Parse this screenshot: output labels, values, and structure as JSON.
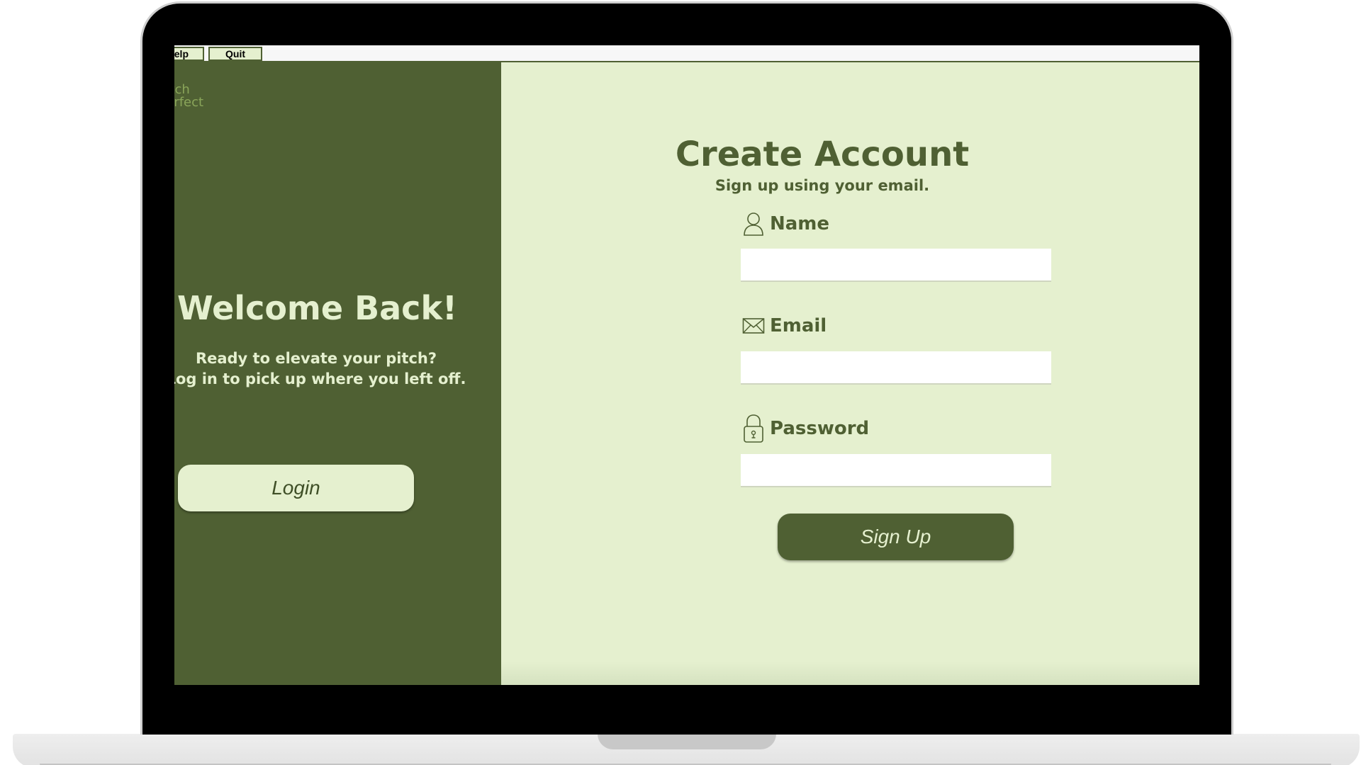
{
  "menubar": {
    "help_label": "Help",
    "quit_label": "Quit"
  },
  "logo": {
    "line1": "Pitch",
    "line2": "Perfect"
  },
  "left_panel": {
    "title": "Welcome Back!",
    "body_line1": "Ready to elevate your pitch?",
    "body_line2": "Log in to pick up where you left off.",
    "login_label": "Login"
  },
  "form": {
    "title": "Create Account",
    "subtitle": "Sign up using your email.",
    "name_label": "Name",
    "name_value": "",
    "email_label": "Email",
    "email_value": "",
    "password_label": "Password",
    "password_value": "",
    "signup_label": "Sign Up"
  },
  "icons": {
    "name": "user-icon",
    "email": "envelope-icon",
    "password": "lock-icon"
  },
  "colors": {
    "dark_green": "#4f6033",
    "light_green": "#e5f0cf",
    "logo_green": "#8aa55a"
  }
}
